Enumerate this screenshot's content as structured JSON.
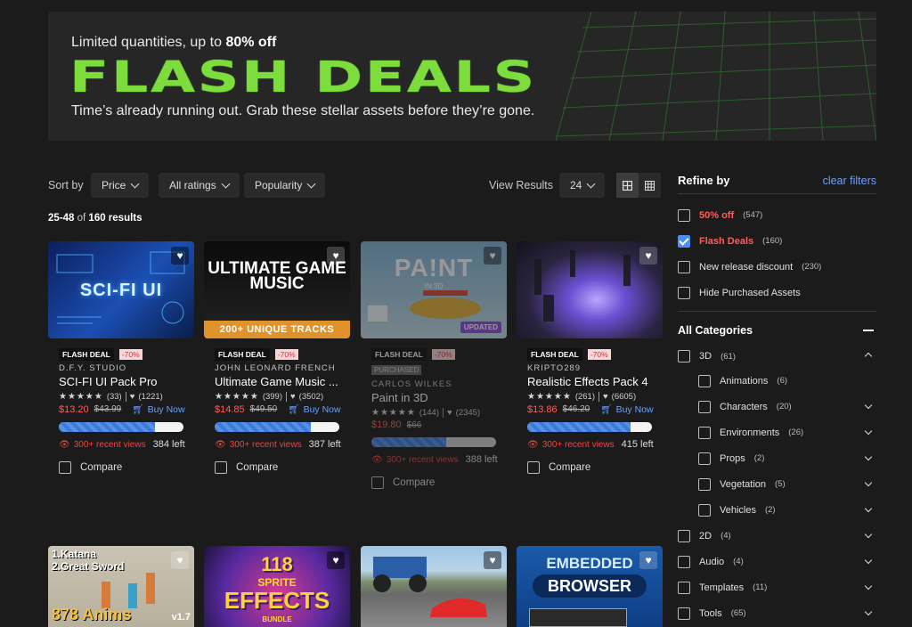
{
  "banner": {
    "subtitle_prefix": "Limited quantities, up to ",
    "subtitle_bold": "80% off",
    "title": "FLASH DEALS",
    "tagline": "Time’s already running out. Grab these stellar assets before they’re gone.",
    "title_color": "#7ddd3c"
  },
  "toolbar": {
    "sort_label": "Sort by",
    "dropdowns": [
      "Price",
      "All ratings",
      "Popularity"
    ],
    "view_results_label": "View Results",
    "per_page": "24",
    "view_icons": [
      "grid-large-icon",
      "grid-small-icon"
    ]
  },
  "results": {
    "range": "25-48",
    "of": "of",
    "total": "160 results"
  },
  "products": [
    {
      "badge": "FLASH DEAL",
      "discount": "-70%",
      "purchased": "",
      "publisher": "D.F.Y. STUDIO",
      "title": "SCI-FI UI Pack Pro",
      "reviews": "(33)",
      "favorites": "(1221)",
      "price": "$13.20",
      "old_price": "$43.99",
      "buy": "Buy Now",
      "progress": 0.77,
      "views": "300+ recent views",
      "left": "384 left",
      "compare": "Compare",
      "thumb_text": "SCI-FI UI"
    },
    {
      "badge": "FLASH DEAL",
      "discount": "-70%",
      "purchased": "",
      "publisher": "JOHN LEONARD FRENCH",
      "title": "Ultimate Game Music ...",
      "reviews": "(399)",
      "favorites": "(3502)",
      "price": "$14.85",
      "old_price": "$49.50",
      "buy": "Buy Now",
      "progress": 0.77,
      "views": "300+ recent views",
      "left": "387 left",
      "compare": "Compare",
      "thumb_text": "ULTIMATE GAME MUSIC",
      "thumb_band": "200+ UNIQUE TRACKS"
    },
    {
      "badge": "FLASH DEAL",
      "discount": "-70%",
      "purchased": "PURCHASED",
      "publisher": "CARLOS WILKES",
      "title": "Paint in 3D",
      "reviews": "(144)",
      "favorites": "(2345)",
      "price": "$19.80",
      "old_price": "$66",
      "buy": "",
      "progress": 0.6,
      "views": "300+ recent views",
      "left": "388 left",
      "compare": "Compare",
      "thumb_text": "PA!NT",
      "thumb_sub": "IN 3D",
      "thumb_tag": "UPDATED"
    },
    {
      "badge": "FLASH DEAL",
      "discount": "-70%",
      "purchased": "",
      "publisher": "KRIPTO289",
      "title": "Realistic Effects Pack 4",
      "reviews": "(261)",
      "favorites": "(6605)",
      "price": "$13.86",
      "old_price": "$46.20",
      "buy": "Buy Now",
      "progress": 0.83,
      "views": "300+ recent views",
      "left": "415 left",
      "compare": "Compare",
      "thumb_text": ""
    }
  ],
  "row2": [
    {
      "text1": "1.Katana",
      "text2": "2.Great Sword",
      "text3": "878 Anims",
      "text4": "v1.7"
    },
    {
      "text1": "118",
      "text2": "SPRITE",
      "text3": "EFFECTS",
      "text4": "BUNDLE"
    },
    {
      "text1": ""
    },
    {
      "text1": "EMBEDDED",
      "text2": "BROWSER"
    }
  ],
  "sidebar": {
    "title": "Refine by",
    "clear": "clear filters",
    "filters": [
      {
        "name": "50% off",
        "count": "(547)",
        "checked": false,
        "red": true
      },
      {
        "name": "Flash Deals",
        "count": "(160)",
        "checked": true,
        "red": true
      },
      {
        "name": "New release discount",
        "count": "(230)",
        "checked": false,
        "red": false
      },
      {
        "name": "Hide Purchased Assets",
        "count": "",
        "checked": false,
        "red": false
      }
    ],
    "categories_title": "All Categories",
    "categories": [
      {
        "name": "3D",
        "count": "(61)",
        "sub": false,
        "arrow": "up"
      },
      {
        "name": "Animations",
        "count": "(6)",
        "sub": true,
        "arrow": ""
      },
      {
        "name": "Characters",
        "count": "(20)",
        "sub": true,
        "arrow": "down"
      },
      {
        "name": "Environments",
        "count": "(26)",
        "sub": true,
        "arrow": "down"
      },
      {
        "name": "Props",
        "count": "(2)",
        "sub": true,
        "arrow": "down"
      },
      {
        "name": "Vegetation",
        "count": "(5)",
        "sub": true,
        "arrow": "down"
      },
      {
        "name": "Vehicles",
        "count": "(2)",
        "sub": true,
        "arrow": "down"
      },
      {
        "name": "2D",
        "count": "(4)",
        "sub": false,
        "arrow": "down"
      },
      {
        "name": "Audio",
        "count": "(4)",
        "sub": false,
        "arrow": "down"
      },
      {
        "name": "Templates",
        "count": "(11)",
        "sub": false,
        "arrow": "down"
      },
      {
        "name": "Tools",
        "count": "(65)",
        "sub": false,
        "arrow": "down"
      }
    ]
  },
  "colors": {
    "accent_blue": "#6da0ff",
    "sale_red": "#ff5d5d",
    "bg": "#1b1b1b"
  }
}
